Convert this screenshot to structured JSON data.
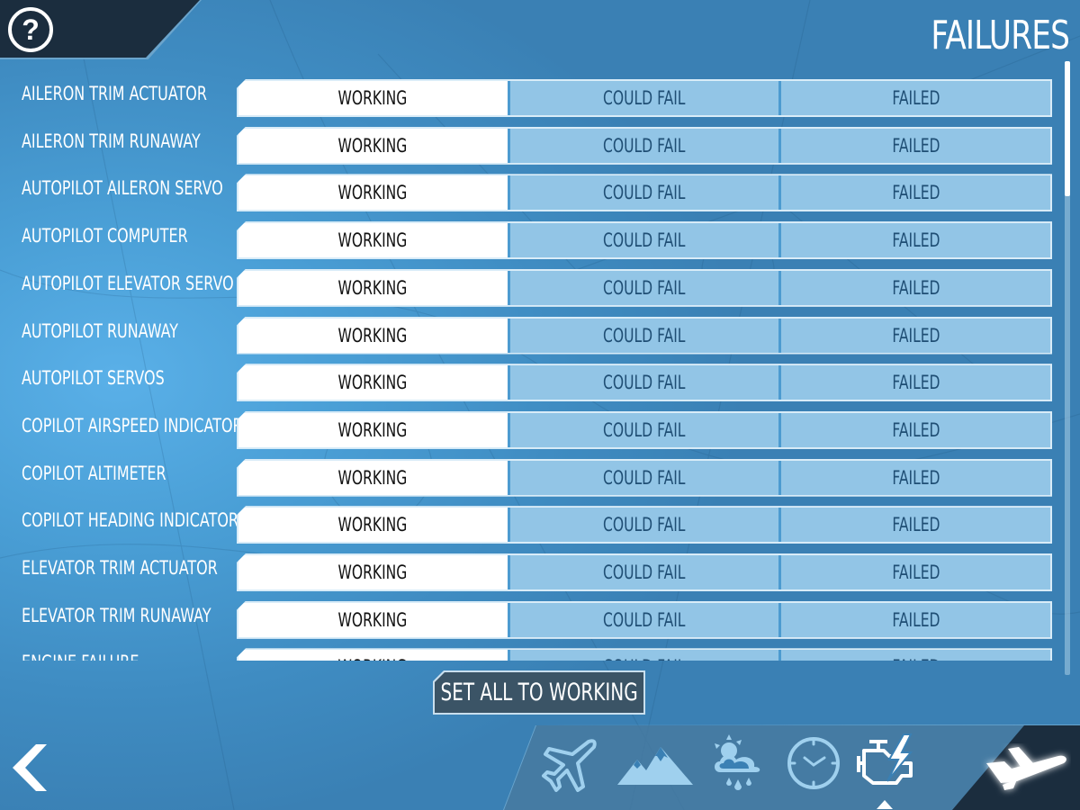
{
  "header": {
    "help_icon_glyph": "?",
    "title": "FAILURES"
  },
  "options": {
    "working": "WORKING",
    "could_fail": "COULD FAIL",
    "failed": "FAILED"
  },
  "failures": [
    {
      "label": "AILERON TRIM ACTUATOR",
      "state": "WORKING"
    },
    {
      "label": "AILERON TRIM RUNAWAY",
      "state": "WORKING"
    },
    {
      "label": "AUTOPILOT AILERON SERVO",
      "state": "WORKING"
    },
    {
      "label": "AUTOPILOT COMPUTER",
      "state": "WORKING"
    },
    {
      "label": "AUTOPILOT ELEVATOR SERVO",
      "state": "WORKING"
    },
    {
      "label": "AUTOPILOT RUNAWAY",
      "state": "WORKING"
    },
    {
      "label": "AUTOPILOT SERVOS",
      "state": "WORKING"
    },
    {
      "label": "COPILOT AIRSPEED INDICATOR",
      "state": "WORKING"
    },
    {
      "label": "COPILOT ALTIMETER",
      "state": "WORKING"
    },
    {
      "label": "COPILOT HEADING INDICATOR",
      "state": "WORKING"
    },
    {
      "label": "ELEVATOR TRIM ACTUATOR",
      "state": "WORKING"
    },
    {
      "label": "ELEVATOR TRIM RUNAWAY",
      "state": "WORKING"
    },
    {
      "label": "ENGINE FAILURE",
      "state": "WORKING"
    }
  ],
  "scroll": {
    "position_fraction": 0.0,
    "visible_fraction": 0.22
  },
  "actions": {
    "set_all_label": "SET ALL TO WORKING"
  },
  "nav": {
    "back_icon": "chevron-left-icon",
    "items": [
      {
        "icon": "airplane-icon",
        "active": false
      },
      {
        "icon": "mountains-icon",
        "active": false
      },
      {
        "icon": "weather-icon",
        "active": false
      },
      {
        "icon": "clock-icon",
        "active": false
      },
      {
        "icon": "engine-failure-icon",
        "active": true
      }
    ],
    "fly_icon": "takeoff-airplane-icon"
  },
  "colors": {
    "background": "#4a9fd6",
    "banner_dark": "#1b2d3e",
    "option_inactive": "#92c5e6",
    "option_inactive_text": "#1f4e74",
    "option_selected": "#ffffff",
    "button_dark": "#3b5466",
    "icon_inactive": "#9fd0ee"
  }
}
